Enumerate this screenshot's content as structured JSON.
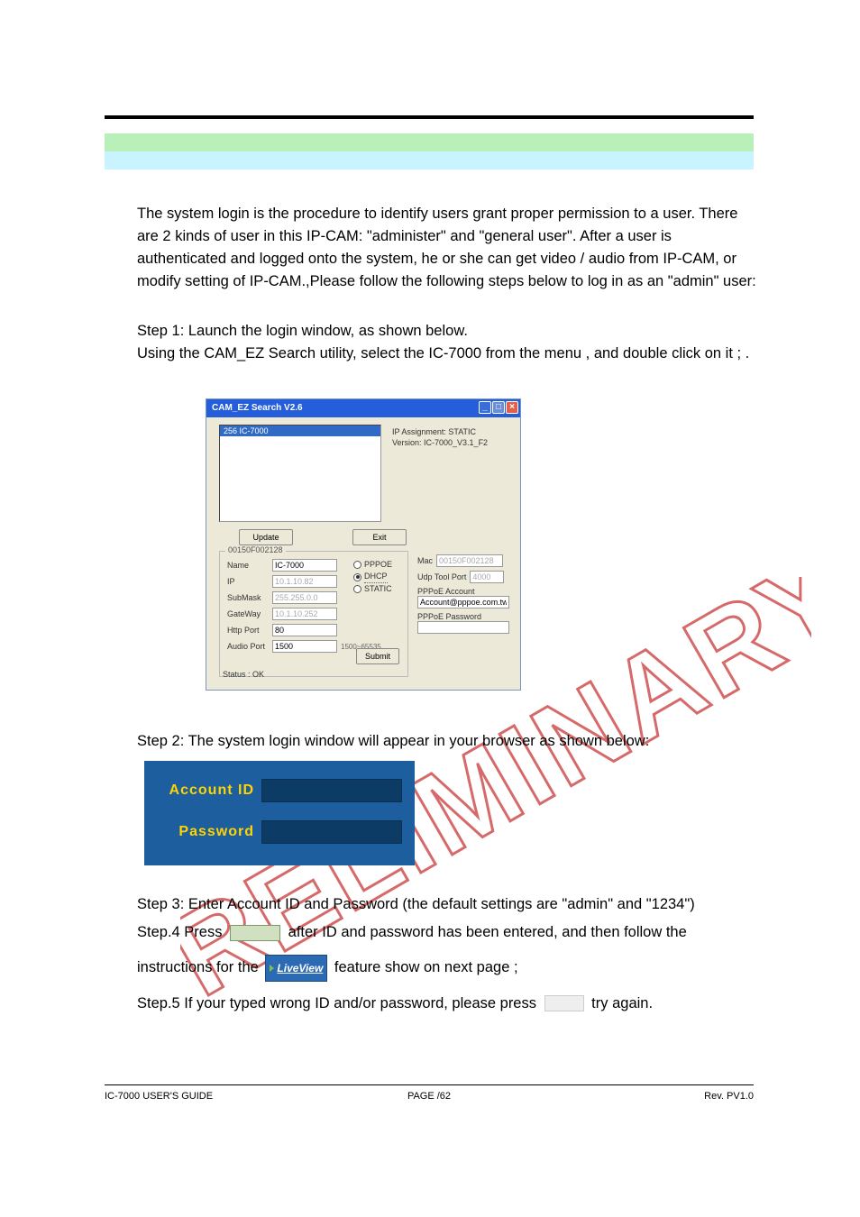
{
  "intro": {
    "p1": "The system login is the procedure to identify users grant proper permission to a user. There are 2 kinds of user in this IP-CAM: \"administer\" and \"general user\". After a user is authenticated and logged onto the system, he or she can get video / audio from IP-CAM, or modify setting of IP-CAM.,Please follow the following steps below to log in as an \"admin\" user:"
  },
  "step1": {
    "line1": "Step 1: Launch the login window, as shown below.",
    "line2": "Using the CAM_EZ Search utility, select the IC-7000 from the menu , and double click on it ;   ."
  },
  "camwin": {
    "title": "CAM_EZ Search V2.6",
    "list_item": "256 IC-7000",
    "info_line1": "IP Assignment: STATIC",
    "info_line2": "Version: IC-7000_V3.1_F2",
    "btn_update": "Update",
    "btn_exit": "Exit",
    "btn_submit": "Submit",
    "group_title": "00150F002128",
    "name_label": "Name",
    "name_value": "IC-7000",
    "ip_label": "IP",
    "ip_value": "10.1.10.82",
    "submask_label": "SubMask",
    "submask_value": "255.255.0.0",
    "gateway_label": "GateWay",
    "gateway_value": "10.1.10.252",
    "httpport_label": "Http Port",
    "httpport_value": "80",
    "audioport_label": "Audio Port",
    "audioport_value": "1500",
    "audioport_range": "1500~65535",
    "radio_pppoe": "PPPOE",
    "radio_dhcp": "DHCP",
    "radio_static": "STATIC",
    "mac_label": "Mac",
    "mac_value": "00150F002128",
    "udp_label": "Udp Tool Port",
    "udp_value": "4000",
    "pppoe_acc_label": "PPPoE Account",
    "pppoe_acc_value": "Account@pppoe.com.tw",
    "pppoe_pwd_label": "PPPoE Password",
    "status": "Status :    OK"
  },
  "step2": "Step 2: The system login window will appear in your browser as shown below:",
  "login": {
    "account_label": "Account ID",
    "password_label": "Password"
  },
  "step3": "Step 3: Enter Account ID and Password   (the default settings are \"admin\" and \"1234\")",
  "step4_a": "Step.4    Press ",
  "step4_b": " after ID and password has been entered, and then follow the",
  "step4_c": "instructions for the ",
  "step4_d": " feature show on next page ;",
  "liveview": "LiveView",
  "step5_a": "Step.5    If your typed wrong ID and/or password, please press ",
  "step5_b": " try again.",
  "footer": {
    "left": "IC-7000 USER'S GUIDE",
    "mid": "PAGE   /62",
    "right": "Rev. PV1.0"
  }
}
